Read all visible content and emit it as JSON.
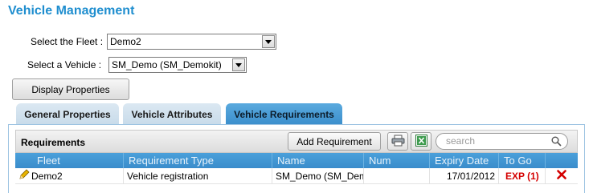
{
  "page": {
    "title": "Vehicle Management"
  },
  "form": {
    "fleet_label": "Select the Fleet :",
    "fleet_value": "Demo2",
    "vehicle_label": "Select a Vehicle :",
    "vehicle_value": "SM_Demo (SM_Demokit)"
  },
  "display_button": "Display Properties",
  "tabs": [
    {
      "label": "General Properties",
      "active": false
    },
    {
      "label": "Vehicle Attributes",
      "active": false
    },
    {
      "label": "Vehicle Requirements",
      "active": true
    }
  ],
  "requirements": {
    "title": "Requirements",
    "add_label": "Add Requirement",
    "search_placeholder": "search",
    "icons": [
      "print-icon",
      "excel-icon",
      "search-icon"
    ],
    "columns": [
      "Fleet",
      "Requirement Type",
      "Name",
      "Num",
      "Expiry Date",
      "To Go"
    ],
    "rows": [
      {
        "fleet": "Demo2",
        "type": "Vehicle registration",
        "name": "SM_Demo (SM_Demokit)",
        "num": "",
        "expiry": "17/01/2012",
        "to_go": "EXP (1)"
      }
    ]
  },
  "colors": {
    "title": "#1f8ecf",
    "tab_active": "#3b8fcc",
    "header": "#4aa0da",
    "expired": "#d40000"
  }
}
